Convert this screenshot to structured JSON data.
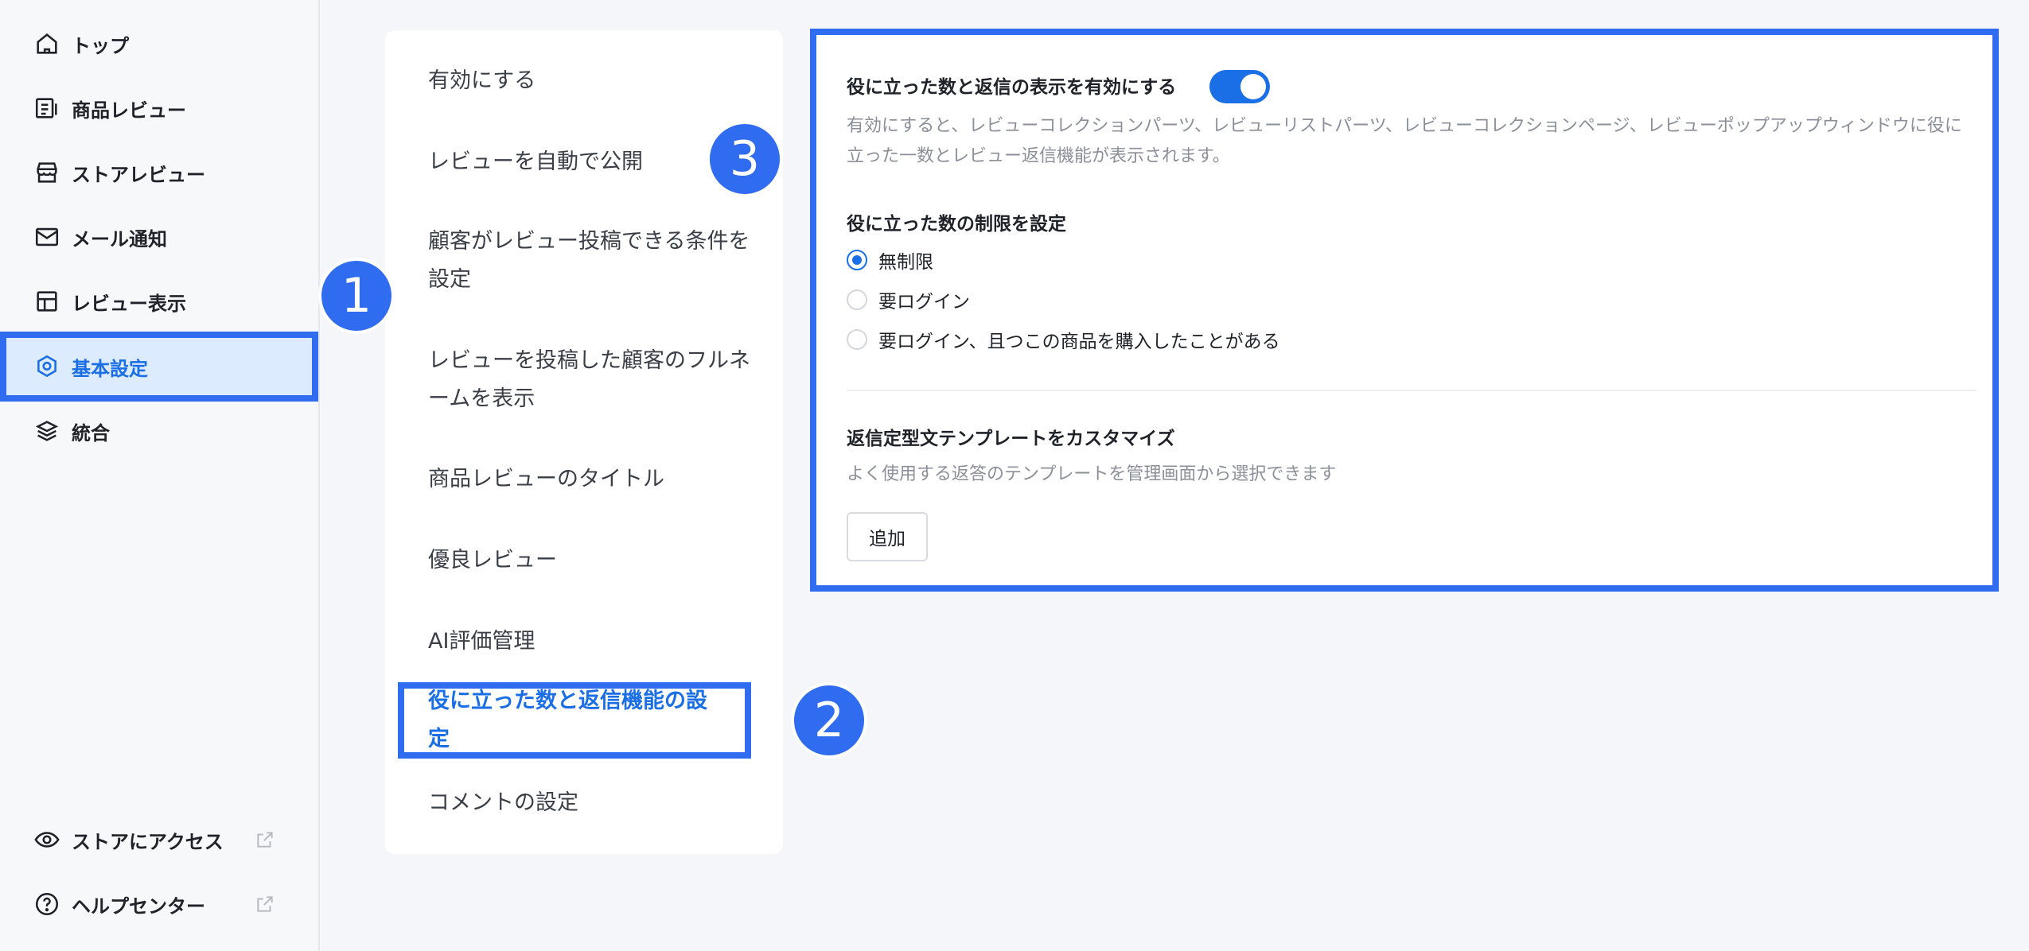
{
  "sidebar": {
    "items": [
      {
        "label": "トップ",
        "icon": "home-icon"
      },
      {
        "label": "商品レビュー",
        "icon": "product-review-icon"
      },
      {
        "label": "ストアレビュー",
        "icon": "store-icon"
      },
      {
        "label": "メール通知",
        "icon": "mail-icon"
      },
      {
        "label": "レビュー表示",
        "icon": "layout-icon"
      },
      {
        "label": "基本設定",
        "icon": "settings-icon"
      },
      {
        "label": "統合",
        "icon": "layers-icon"
      }
    ],
    "bottom": [
      {
        "label": "ストアにアクセス",
        "icon": "eye-icon"
      },
      {
        "label": "ヘルプセンター",
        "icon": "help-icon"
      }
    ]
  },
  "menu": {
    "items": [
      "有効にする",
      "レビューを自動で公開",
      "顧客がレビュー投稿できる条件を設定",
      "レビューを投稿した顧客のフルネームを表示",
      "商品レビューのタイトル",
      "優良レビュー",
      "AI評価管理",
      "役に立った数と返信機能の設定",
      "コメントの設定"
    ]
  },
  "badges": [
    "1",
    "2",
    "3"
  ],
  "panel": {
    "enable_title": "役に立った数と返信の表示を有効にする",
    "enable_desc": "有効にすると、レビューコレクションパーツ、レビューリストパーツ、レビューコレクションページ、レビューポップアップウィンドウに役に立った一数とレビュー返信機能が表示されます。",
    "limit_title": "役に立った数の制限を設定",
    "radio_options": [
      "無制限",
      "要ログイン",
      "要ログイン、且つこの商品を購入したことがある"
    ],
    "template_title": "返信定型文テンプレートをカスタマイズ",
    "template_desc": "よく使用する返答のテンプレートを管理画面から選択できます",
    "add_label": "追加"
  },
  "colors": {
    "accent": "#1a6ee6",
    "highlight": "#2f6cf0"
  }
}
